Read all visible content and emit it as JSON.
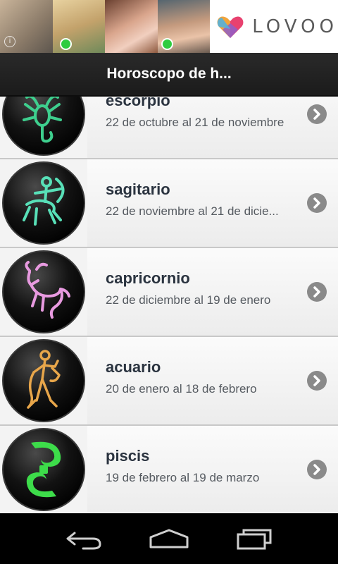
{
  "ad": {
    "brand_text": "LOVOO",
    "accent": "#e8416f"
  },
  "header": {
    "title": "Horoscopo de h..."
  },
  "signs": [
    {
      "name": "escorpio",
      "dates": "22 de octubre al 21 de noviembre",
      "color": "#3ecf8e",
      "icon": "scorpio-icon"
    },
    {
      "name": "sagitario",
      "dates": "22 de noviembre al 21 de dicie...",
      "color": "#58e0b8",
      "icon": "sagittarius-icon"
    },
    {
      "name": "capricornio",
      "dates": "22 de diciembre al 19 de enero",
      "color": "#e89ae0",
      "icon": "capricorn-icon"
    },
    {
      "name": "acuario",
      "dates": "20 de enero al 18 de febrero",
      "color": "#e8a64a",
      "icon": "aquarius-icon"
    },
    {
      "name": "piscis",
      "dates": "19 de febrero al 19 de marzo",
      "color": "#3ddc4a",
      "icon": "pisces-icon"
    }
  ],
  "nav": {
    "back_icon": "back-icon",
    "home_icon": "home-icon",
    "recents_icon": "recents-icon"
  }
}
